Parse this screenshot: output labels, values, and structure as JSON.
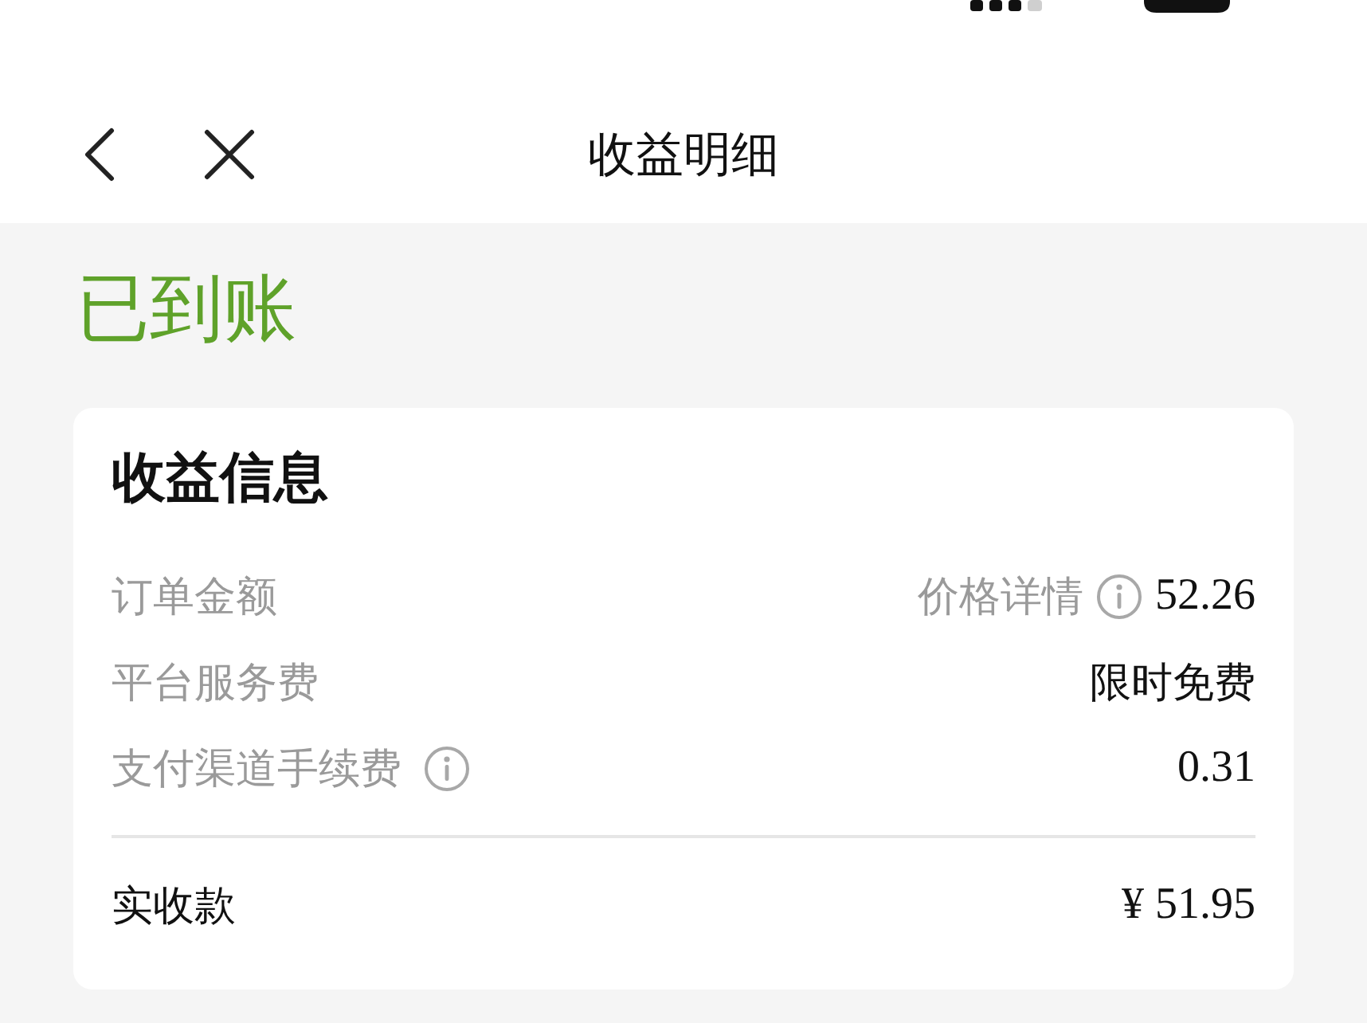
{
  "nav": {
    "title": "收益明细"
  },
  "status": {
    "label": "已到账"
  },
  "card": {
    "title": "收益信息",
    "rows": [
      {
        "label": "订单金额",
        "detail": "价格详情",
        "detail_info": true,
        "value": "52.26",
        "kind": "amount"
      },
      {
        "label": "平台服务费",
        "value": "限时免费",
        "kind": "note"
      },
      {
        "label": "支付渠道手续费",
        "info": true,
        "value": "0.31",
        "kind": "amount"
      }
    ],
    "total": {
      "label": "实收款",
      "value": "¥ 51.95"
    }
  }
}
